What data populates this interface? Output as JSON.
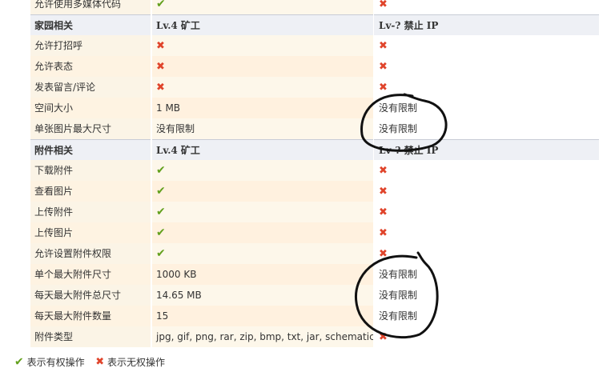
{
  "labels": [
    {
      "text": "允许使用多媒体代码",
      "type": "row"
    },
    {
      "text": "家园相关",
      "type": "hdr"
    },
    {
      "text": "允许打招呼",
      "type": "row"
    },
    {
      "text": "允许表态",
      "type": "row"
    },
    {
      "text": "发表留言/评论",
      "type": "row"
    },
    {
      "text": "空间大小",
      "type": "row"
    },
    {
      "text": "单张图片最大尺寸",
      "type": "row"
    },
    {
      "text": "附件相关",
      "type": "hdr"
    },
    {
      "text": "下载附件",
      "type": "row"
    },
    {
      "text": "查看图片",
      "type": "row"
    },
    {
      "text": "上传附件",
      "type": "row"
    },
    {
      "text": "上传图片",
      "type": "row"
    },
    {
      "text": "允许设置附件权限",
      "type": "row"
    },
    {
      "text": "单个最大附件尺寸",
      "type": "row"
    },
    {
      "text": "每天最大附件总尺寸",
      "type": "row"
    },
    {
      "text": "每天最大附件数量",
      "type": "row"
    },
    {
      "text": "附件类型",
      "type": "row"
    }
  ],
  "mid": [
    {
      "text": "✔",
      "type": "v"
    },
    {
      "text": "Lv.4 矿工",
      "type": "hdr"
    },
    {
      "text": "✖",
      "type": "x"
    },
    {
      "text": "✖",
      "type": "x"
    },
    {
      "text": "✖",
      "type": "x"
    },
    {
      "text": "1 MB",
      "type": "text"
    },
    {
      "text": "没有限制",
      "type": "text"
    },
    {
      "text": "Lv.4 矿工",
      "type": "hdr"
    },
    {
      "text": "✔",
      "type": "v"
    },
    {
      "text": "✔",
      "type": "v"
    },
    {
      "text": "✔",
      "type": "v"
    },
    {
      "text": "✔",
      "type": "v"
    },
    {
      "text": "✔",
      "type": "v"
    },
    {
      "text": "1000 KB",
      "type": "text"
    },
    {
      "text": "14.65 MB",
      "type": "text"
    },
    {
      "text": "15",
      "type": "text"
    },
    {
      "text": "jpg, gif, png, rar, zip, bmp, txt, jar, schematic, yml",
      "type": "text"
    }
  ],
  "right_group1": [
    {
      "text": "✖",
      "type": "x"
    },
    {
      "text": "Lv-? 禁止 IP",
      "type": "hdr"
    },
    {
      "text": "✖",
      "type": "x"
    },
    {
      "text": "✖",
      "type": "x"
    },
    {
      "text": "✖",
      "type": "x"
    },
    {
      "text": "没有限制",
      "type": "text"
    },
    {
      "text": "没有限制",
      "type": "text"
    },
    {
      "text": "Lv-? 禁止 IP",
      "type": "hdr"
    },
    {
      "text": "✖",
      "type": "x"
    },
    {
      "text": "✖",
      "type": "x"
    },
    {
      "text": "✖",
      "type": "x"
    },
    {
      "text": "✖",
      "type": "x"
    },
    {
      "text": "✖",
      "type": "x"
    },
    {
      "text": "没有限制",
      "type": "text"
    },
    {
      "text": "没有限制",
      "type": "text"
    },
    {
      "text": "没有限制",
      "type": "text"
    },
    {
      "text": "✖",
      "type": "x"
    }
  ],
  "legend": {
    "allowed_icon": "✔",
    "allowed_text": "表示有权操作",
    "denied_icon": "✖",
    "denied_text": "表示无权操作"
  },
  "colors": {
    "header_bg": "#eef0f5",
    "row_bg": "#fdf7ea",
    "check": "#62a01c",
    "cross": "#e0442b"
  }
}
